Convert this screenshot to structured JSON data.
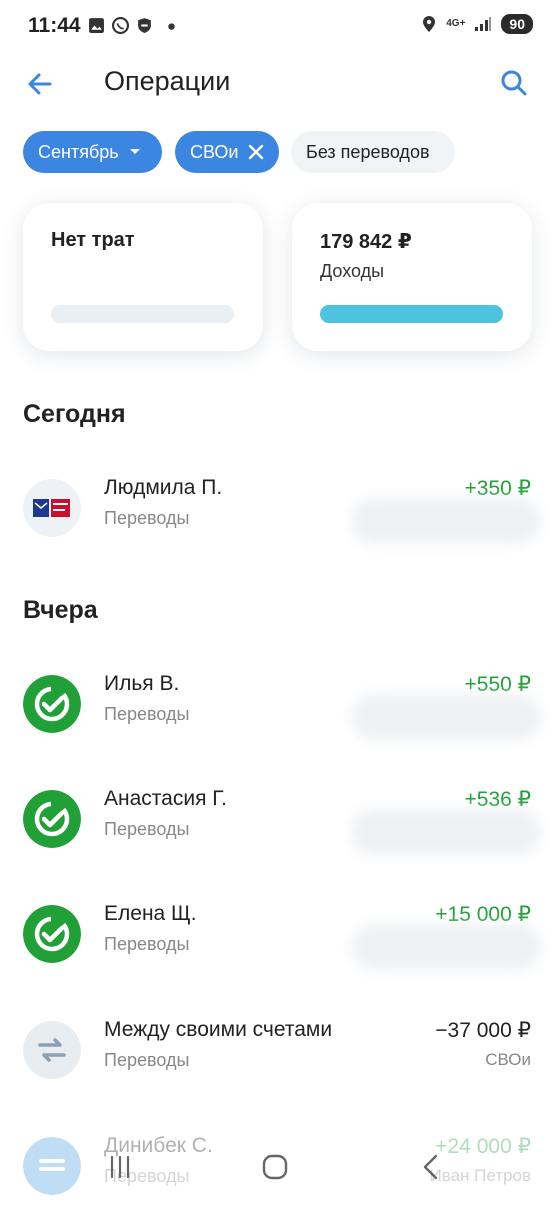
{
  "status_bar": {
    "time": "11:44",
    "network": "4G+",
    "battery": "90"
  },
  "header": {
    "title": "Операции"
  },
  "filters": [
    {
      "label": "Сентябрь"
    },
    {
      "label": "СВОи"
    },
    {
      "label": "Без переводов"
    }
  ],
  "cards": {
    "expenses": {
      "label": "Нет трат",
      "fill": 0
    },
    "income": {
      "amount": "179 842 ₽",
      "label": "Доходы",
      "fill": 1.0
    }
  },
  "sections": {
    "today": "Сегодня",
    "yesterday": "Вчера"
  },
  "transactions": [
    {
      "name": "Людмила П.",
      "category": "Переводы",
      "amount": "+350 ₽",
      "account": ""
    },
    {
      "name": "Илья В.",
      "category": "Переводы",
      "amount": "+550 ₽",
      "account": ""
    },
    {
      "name": "Анастасия Г.",
      "category": "Переводы",
      "amount": "+536 ₽",
      "account": ""
    },
    {
      "name": "Елена Щ.",
      "category": "Переводы",
      "amount": "+15 000 ₽",
      "account": ""
    },
    {
      "name": "Между своими счетами",
      "category": "Переводы",
      "amount": "−37 000 ₽",
      "account": "СВОи"
    },
    {
      "name": "Динибек С.",
      "category": "Переводы",
      "amount": "+24 000 ₽",
      "account": "Иван Петров"
    }
  ],
  "colors": {
    "accent": "#3b86e0",
    "positive": "#21a038",
    "income_bar": "#4ec3e0",
    "sber_green": "#21a038"
  }
}
